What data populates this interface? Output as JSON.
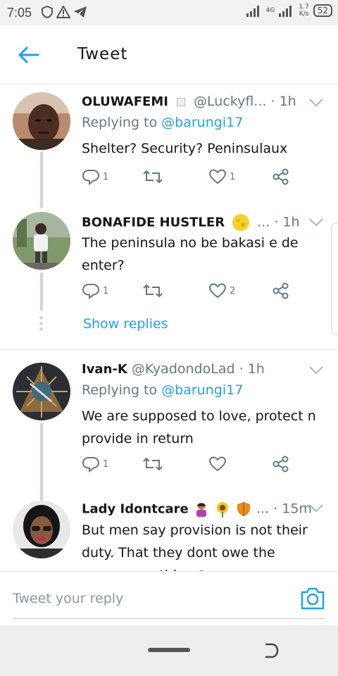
{
  "status_bar": {
    "time": "7:05",
    "network": "4G",
    "speed_value": "1.7",
    "speed_unit": "K/s",
    "battery": "52"
  },
  "header": {
    "title": "Tweet",
    "back_icon": "arrow-left-icon"
  },
  "accent_color": "#1da1f2",
  "tweets": [
    {
      "name": "OLUWAFEMI",
      "handle": "@Luckyfl...",
      "time": "1h",
      "replying_prefix": "Replying to",
      "replying_to": "@barungi17",
      "text": "Shelter? Security? Peninsulaux",
      "replies": "1",
      "retweets": "",
      "likes": "1"
    },
    {
      "name": "BONAFIDE HUSTLER",
      "handle": "...",
      "time": "1h",
      "text": "The peninsula no be bakasi e de enter?",
      "replies": "1",
      "retweets": "",
      "likes": "2",
      "show_replies": "Show replies"
    },
    {
      "name": "Ivan-K",
      "handle": "@KyadondoLad",
      "time": "1h",
      "replying_prefix": "Replying to",
      "replying_to": "@barungi17",
      "text": "We are supposed to love, protect n provide in return",
      "replies": "1",
      "retweets": "",
      "likes": ""
    },
    {
      "name": "Lady Idontcare",
      "handle": "...",
      "time": "15m",
      "text": "But men say provision is not their duty. That they dont owe the woman anything"
    }
  ],
  "reply_bar": {
    "placeholder": "Tweet your reply"
  }
}
